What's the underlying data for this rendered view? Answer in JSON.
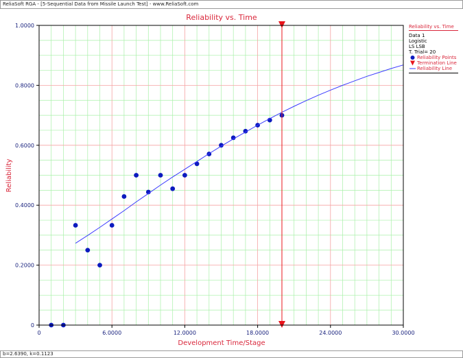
{
  "window": {
    "title": "ReliaSoft RGA - [5-Sequential Data from Missile Launch Test] - www.ReliaSoft.com",
    "status": "b=2.6390, k=0.1123"
  },
  "legend": {
    "title": "Reliability vs. Time",
    "info": [
      "Data 1",
      "Logistic",
      "LS LSB",
      "T. Trial= 20"
    ],
    "items": {
      "points": "Reliability Points",
      "termination": "Termination Line",
      "line": "Reliability Line"
    }
  },
  "colors": {
    "title": "#d9263a",
    "axis_label": "#d9263a",
    "tick_label": "#1a237e",
    "points": "#0d1bbf",
    "line": "#3a3aff",
    "termination": "#e8141b",
    "major_grid": "#f5a3a3",
    "minor_grid": "#a8f0a8"
  },
  "chart_data": {
    "type": "scatter",
    "title": "Reliability vs. Time",
    "xlabel": "Development Time/Stage",
    "ylabel": "Reliability",
    "xlim": [
      0,
      30
    ],
    "ylim": [
      0,
      1
    ],
    "x_ticks": [
      0,
      6,
      12,
      18,
      24,
      30
    ],
    "x_tick_labels": [
      "0",
      "6.0000",
      "12.0000",
      "18.0000",
      "24.0000",
      "30.0000"
    ],
    "y_ticks": [
      0,
      0.2,
      0.4,
      0.6,
      0.8,
      1.0
    ],
    "y_tick_labels": [
      "0",
      "0.2000",
      "0.4000",
      "0.6000",
      "0.8000",
      "1.0000"
    ],
    "grid": true,
    "legend_position": "right",
    "series": [
      {
        "name": "Reliability Points",
        "kind": "points",
        "x": [
          1,
          2,
          3,
          4,
          5,
          6,
          7,
          8,
          9,
          10,
          11,
          12,
          13,
          14,
          15,
          16,
          17,
          18,
          19,
          20
        ],
        "y": [
          0,
          0,
          0.333,
          0.25,
          0.2,
          0.333,
          0.429,
          0.5,
          0.444,
          0.5,
          0.455,
          0.5,
          0.538,
          0.571,
          0.6,
          0.625,
          0.647,
          0.667,
          0.684,
          0.7
        ]
      },
      {
        "name": "Reliability Line",
        "kind": "line",
        "x": [
          3,
          4,
          5,
          6,
          7,
          8,
          9,
          10,
          11,
          12,
          13,
          14,
          15,
          16,
          17,
          18,
          19,
          20,
          21,
          22,
          23,
          24,
          25,
          26,
          27,
          28,
          29,
          30
        ],
        "y": [
          0.273,
          0.299,
          0.326,
          0.354,
          0.382,
          0.411,
          0.439,
          0.467,
          0.494,
          0.52,
          0.546,
          0.572,
          0.597,
          0.621,
          0.644,
          0.667,
          0.689,
          0.71,
          0.73,
          0.749,
          0.767,
          0.784,
          0.8,
          0.815,
          0.83,
          0.843,
          0.856,
          0.868
        ]
      },
      {
        "name": "Termination Line",
        "kind": "vline",
        "x": 20
      }
    ]
  }
}
